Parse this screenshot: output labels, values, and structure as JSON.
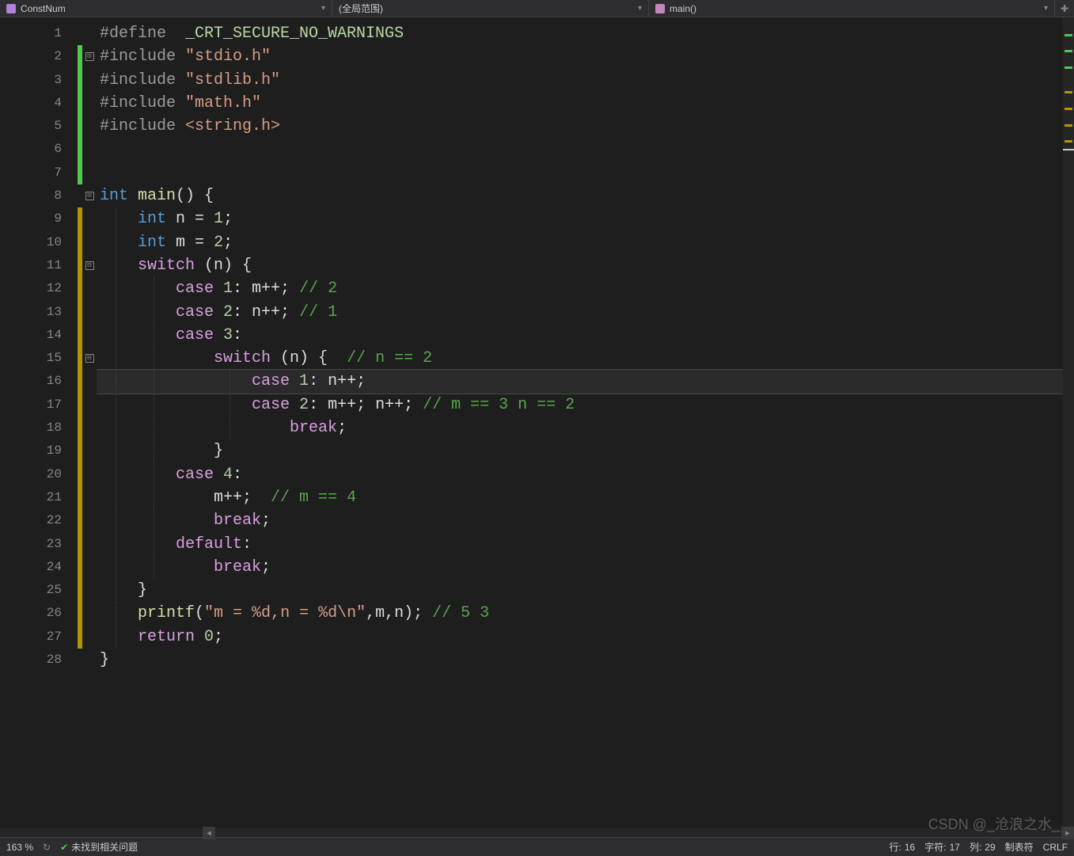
{
  "nav": {
    "project": "ConstNum",
    "scope": "(全局范围)",
    "symbol": "main()"
  },
  "lines": [
    1,
    2,
    3,
    4,
    5,
    6,
    7,
    8,
    9,
    10,
    11,
    12,
    13,
    14,
    15,
    16,
    17,
    18,
    19,
    20,
    21,
    22,
    23,
    24,
    25,
    26,
    27,
    28
  ],
  "fold": {
    "l2": "⊟",
    "l8": "⊟",
    "l11": "⊟",
    "l15": "⊟"
  },
  "code": {
    "l1": {
      "pp": "#define",
      "macro": "  _CRT_SECURE_NO_WARNINGS"
    },
    "l2": {
      "pp": "#include",
      "str": " \"stdio.h\""
    },
    "l3": {
      "pp": "#include",
      "str": " \"stdlib.h\""
    },
    "l4": {
      "pp": "#include",
      "str": " \"math.h\""
    },
    "l5": {
      "pp": "#include",
      "br": " <string.h>"
    },
    "l8": {
      "kw": "int ",
      "fn": "main",
      "rest": "() {"
    },
    "l9": {
      "indent": "    ",
      "kw": "int ",
      "v": "n",
      "rest": " = ",
      "n": "1",
      "sc": ";"
    },
    "l10": {
      "indent": "    ",
      "kw": "int ",
      "v": "m",
      "rest": " = ",
      "n": "2",
      "sc": ";"
    },
    "l11": {
      "indent": "    ",
      "kw": "switch",
      "rest": " (n) {"
    },
    "l12": {
      "indent": "        ",
      "kw": "case ",
      "n": "1",
      "rest": ": m++; ",
      "cm": "// 2"
    },
    "l13": {
      "indent": "        ",
      "kw": "case ",
      "n": "2",
      "rest": ": n++; ",
      "cm": "// 1"
    },
    "l14": {
      "indent": "        ",
      "kw": "case ",
      "n": "3",
      "rest": ":"
    },
    "l15": {
      "indent": "            ",
      "kw": "switch",
      "rest": " (n) {  ",
      "cm": "// n == 2"
    },
    "l16": {
      "indent": "                ",
      "kw": "case ",
      "n": "1",
      "rest": ": n++;"
    },
    "l17": {
      "indent": "                ",
      "kw": "case ",
      "n": "2",
      "rest": ": m++; n++; ",
      "cm": "// m == 3 n == 2"
    },
    "l18": {
      "indent": "                    ",
      "kw": "break",
      "rest": ";"
    },
    "l19": {
      "indent": "            ",
      "rest": "}"
    },
    "l20": {
      "indent": "        ",
      "kw": "case ",
      "n": "4",
      "rest": ":"
    },
    "l21": {
      "indent": "            ",
      "rest": "m++;  ",
      "cm": "// m == 4"
    },
    "l22": {
      "indent": "            ",
      "kw": "break",
      "rest": ";"
    },
    "l23": {
      "indent": "        ",
      "kw": "default",
      "rest": ":"
    },
    "l24": {
      "indent": "            ",
      "kw": "break",
      "rest": ";"
    },
    "l25": {
      "indent": "    ",
      "rest": "}"
    },
    "l26": {
      "indent": "    ",
      "fn": "printf",
      "p1": "(",
      "str": "\"m = %d,n = %d\\n\"",
      "p2": ",m,n); ",
      "cm": "// 5 3"
    },
    "l27": {
      "indent": "    ",
      "kw": "return ",
      "n": "0",
      "rest": ";"
    },
    "l28": {
      "rest": "}"
    }
  },
  "status": {
    "zoom": "163 %",
    "issues": "未找到相关问题",
    "line_lbl": "行:",
    "line_val": "16",
    "char_lbl": "字符:",
    "char_val": "17",
    "col_lbl": "列:",
    "col_val": "29",
    "tabs": "制表符",
    "eol": "CRLF"
  },
  "watermark": "CSDN @_沧浪之水_"
}
